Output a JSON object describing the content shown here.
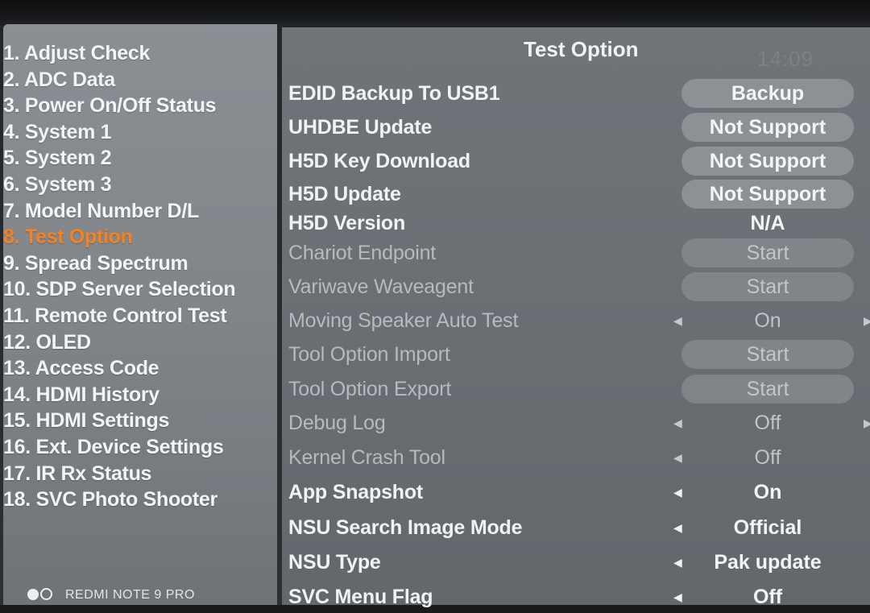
{
  "menu": {
    "items": [
      "1. Adjust Check",
      "2. ADC Data",
      "3. Power On/Off Status",
      "4. System 1",
      "5. System 2",
      "6. System 3",
      "7. Model Number D/L",
      "8. Test Option",
      "9. Spread Spectrum",
      "10. SDP Server Selection",
      "11. Remote Control Test",
      "12. OLED",
      "13. Access Code",
      "14. HDMI History",
      "15. HDMI Settings",
      "16. Ext. Device Settings",
      "17. IR Rx Status",
      "18. SVC Photo Shooter"
    ],
    "active_item": "8. Test Option"
  },
  "panel": {
    "title": "Test Option",
    "clock": "14:09"
  },
  "options": [
    {
      "label": "EDID Backup To USB1",
      "control": "Backup",
      "kind": "button",
      "enabled": true
    },
    {
      "label": "UHDBE Update",
      "control": "Not Support",
      "kind": "button",
      "enabled": true
    },
    {
      "label": "H5D Key Download",
      "control": "Not Support",
      "kind": "button",
      "enabled": true
    },
    {
      "label": "H5D Update",
      "control": "Not Support",
      "kind": "button",
      "enabled": true
    },
    {
      "label": "H5D Version",
      "control": "N/A",
      "kind": "value",
      "enabled": true
    },
    {
      "label": "Chariot Endpoint",
      "control": "Start",
      "kind": "button",
      "enabled": false
    },
    {
      "label": "Variwave Waveagent",
      "control": "Start",
      "kind": "button",
      "enabled": false
    },
    {
      "label": "Moving Speaker Auto Test",
      "control": "On",
      "kind": "select",
      "enabled": false
    },
    {
      "label": "Tool Option Import",
      "control": "Start",
      "kind": "button",
      "enabled": false
    },
    {
      "label": "Tool Option Export",
      "control": "Start",
      "kind": "button",
      "enabled": false
    },
    {
      "label": "Debug Log",
      "control": "Off",
      "kind": "select",
      "enabled": false
    },
    {
      "label": "Kernel Crash Tool",
      "control": "Off",
      "kind": "select",
      "enabled": false
    },
    {
      "label": "App Snapshot",
      "control": "On",
      "kind": "select",
      "enabled": true
    },
    {
      "label": "NSU Search Image Mode",
      "control": "Official",
      "kind": "select",
      "enabled": true
    },
    {
      "label": "NSU Type",
      "control": "Pak update",
      "kind": "select",
      "enabled": true
    },
    {
      "label": "SVC Menu Flag",
      "control": "Off",
      "kind": "select",
      "enabled": true
    }
  ],
  "watermark": {
    "text": "REDMI NOTE 9 PRO"
  },
  "colors": {
    "active_item": "#f5821f",
    "left_panel": "#858a8f",
    "right_panel": "#6b7075",
    "button": "#8d9196"
  }
}
